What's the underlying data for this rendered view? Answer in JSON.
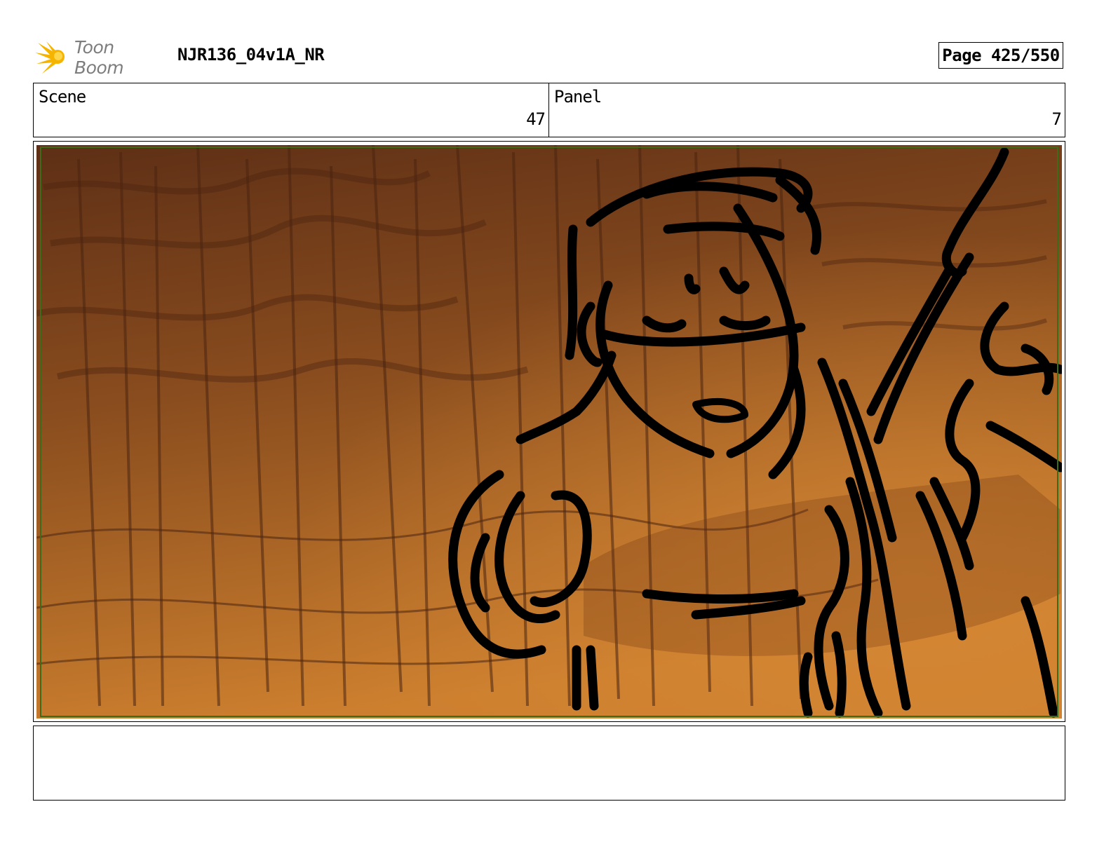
{
  "header": {
    "logo_text": "Toon Boom",
    "logo_icon": "toon-boom-burst-icon",
    "title": "NJR136_04v1A_NR",
    "page_label": "Page 425/550"
  },
  "info": {
    "scene_label": "Scene",
    "scene_value": "47",
    "panel_label": "Panel",
    "panel_value": "7"
  },
  "panel_image": {
    "description_icon": "storyboard-sketch-image",
    "colors": {
      "sky_top": "#6a3a1c",
      "sky_bottom": "#c97a2a",
      "ink": "#000000",
      "safe_frame": "#3c6b1a"
    }
  },
  "notes": {
    "text": ""
  }
}
